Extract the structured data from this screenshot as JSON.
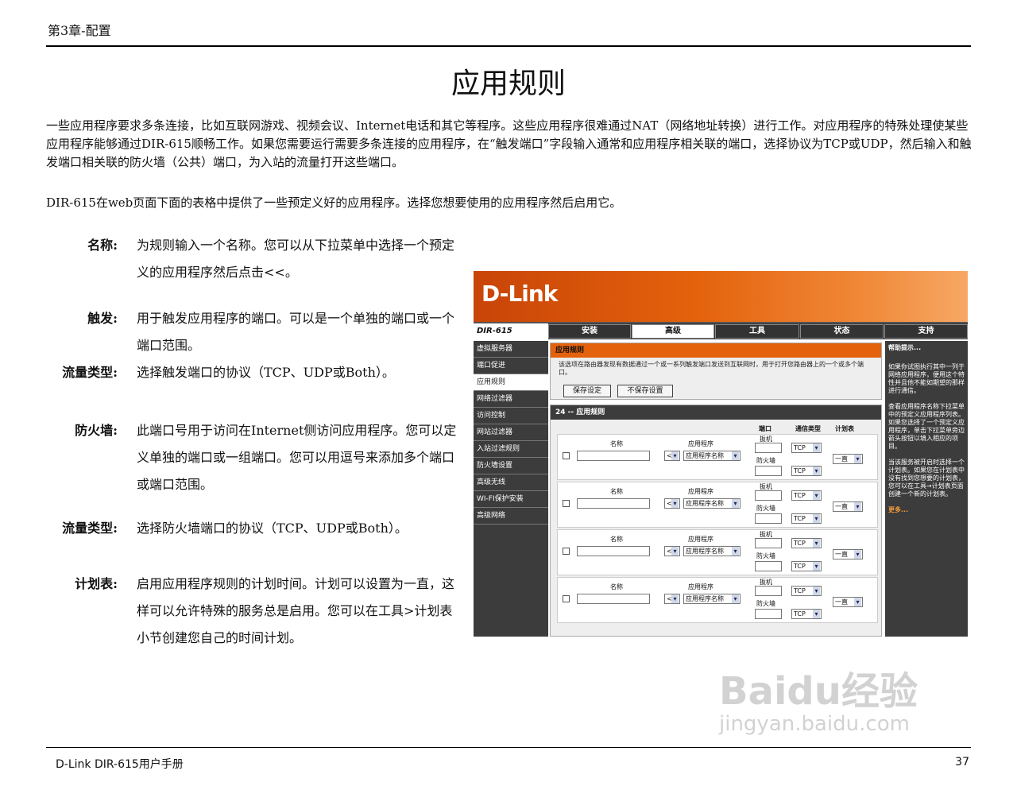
{
  "header": {
    "chapter": "第3章-配置"
  },
  "title": "应用规则",
  "intro": {
    "paragraph1": "一些应用程序要求多条连接，比如互联网游戏、视频会议、Internet电话和其它等程序。这些应用程序很难通过NAT（网络地址转换）进行工作。对应用程序的特殊处理使某些应用程序能够通过DIR-615顺畅工作。如果您需要运行需要多条连接的应用程序，在“触发端口”字段输入通常和应用程序相关联的端口，选择协议为TCP或UDP，然后输入和触发端口相关联的防火墙（公共）端口，为入站的流量打开这些端口。",
    "paragraph2": "DIR-615在web页面下面的表格中提供了一些预定义好的应用程序。选择您想要使用的应用程序然后启用它。"
  },
  "definitions": [
    {
      "term": "名称:",
      "desc": "为规则输入一个名称。您可以从下拉菜单中选择一个预定义的应用程序然后点击<<。"
    },
    {
      "term": "触发:",
      "desc": "用于触发应用程序的端口。可以是一个单独的端口或一个端口范围。"
    },
    {
      "term": "流量类型:",
      "desc": "选择触发端口的协议（TCP、UDP或Both）。"
    },
    {
      "term": "防火墙:",
      "desc": "此端口号用于访问在Internet侧访问应用程序。您可以定义单独的端口或一组端口。您可以用逗号来添加多个端口或端口范围。"
    },
    {
      "term": "流量类型:",
      "desc": "选择防火墙端口的协议（TCP、UDP或Both）。"
    },
    {
      "term": "计划表:",
      "desc": "启用应用程序规则的计划时间。计划可以设置为一直，这样可以允许特殊的服务总是启用。您可以在工具>计划表小节创建您自己的时间计划。"
    }
  ],
  "screenshot": {
    "brand": "D-Link",
    "model": "DIR-615",
    "tabs": [
      "安装",
      "高级",
      "工具",
      "状态",
      "支持"
    ],
    "active_tab": "高级",
    "sidebar": [
      "虚拟服务器",
      "端口促进",
      "应用规则",
      "网络过滤器",
      "访问控制",
      "网站过滤器",
      "入站过滤规则",
      "防火墙设置",
      "高级无线",
      "WI-FI保护安装",
      "高级网络"
    ],
    "active_sidebar": "应用规则",
    "panel": {
      "heading": "应用规则",
      "text": "该选项在路由器发现有数据通过一个或一系列触发端口发送到互联网时，用于打开您路由器上的一个或多个端口。",
      "save_label": "保存设定",
      "nosave_label": "不保存设置"
    },
    "rules_heading": "24 -- 应用规则",
    "col_port": "端口",
    "col_type": "通信类型",
    "col_schedule": "计划表",
    "row": {
      "name_label": "名称",
      "app_label": "应用程序",
      "arrow": "<<",
      "app_select": "应用程序名称",
      "trigger_label": "扳机",
      "firewall_label": "防火墙",
      "proto": "TCP",
      "schedule": "一直"
    },
    "tips": {
      "heading": "帮助提示...",
      "t1": "如果你试图执行其中一列于网络应用程序，便用这个特性并且他不能如期望的那样进行通信。",
      "t2": "查看应用程序名称下拉菜单中的预定义应用程序列表。如果您选择了一个预定义应用程序，单击下拉菜单旁边箭头按钮以填入相应的项目。",
      "t3": "当该服务被开启时选择一个计划表。如果您在计划表中没有找到您想要的计划表，您可以在工具→计划表页面创建一个新的计划表。",
      "more": "更多..."
    }
  },
  "watermark": {
    "line1": "Baidu经验",
    "line2": "jingyan.baidu.com"
  },
  "footer": {
    "left": "D-Link DIR-615用户手册",
    "page": "37"
  }
}
